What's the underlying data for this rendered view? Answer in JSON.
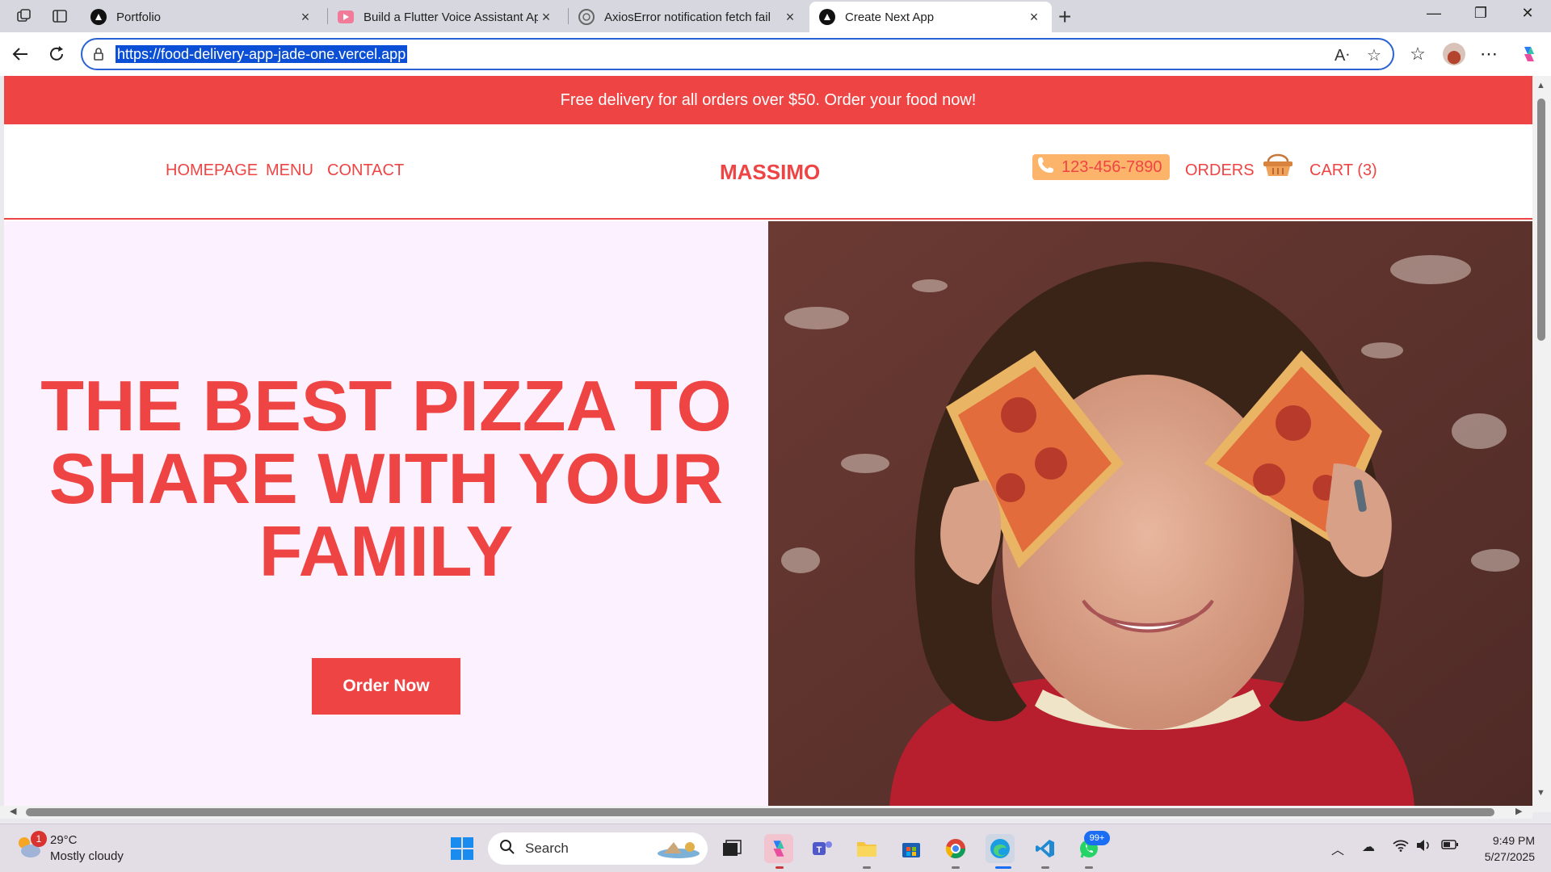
{
  "browser": {
    "tabs": [
      {
        "title": "Portfolio",
        "favicon": "vercel-triangle-icon"
      },
      {
        "title": "Build a Flutter Voice Assistant App",
        "favicon": "youtube-icon"
      },
      {
        "title": "AxiosError notification fetch fail",
        "favicon": "openai-icon"
      },
      {
        "title": "Create Next App",
        "favicon": "vercel-triangle-icon",
        "active": true
      }
    ],
    "new_tab_label": "+",
    "url": "https://food-delivery-app-jade-one.vercel.app"
  },
  "page": {
    "promo_text": "Free delivery for all orders over $50. Order your food now!",
    "nav_links": [
      "HOMEPAGE",
      "MENU",
      "CONTACT"
    ],
    "brand": "MASSIMO",
    "phone": "123-456-7890",
    "orders_label": "ORDERS",
    "cart_label": "CART (3)",
    "hero_title": "THE BEST PIZZA TO SHARE WITH YOUR FAMILY",
    "cta_label": "Order Now",
    "hero_image": "smiling person holding two pizza slices over eyes",
    "colors": {
      "accent": "#ef4444",
      "phone_bg": "#fcb36a",
      "hero_bg": "#fcf1fe"
    }
  },
  "taskbar": {
    "weather_temp": "29°C",
    "weather_desc": "Mostly cloudy",
    "weather_badge": "1",
    "search_placeholder": "Search",
    "notification_badge": "99+",
    "time": "9:49 PM",
    "date": "5/27/2025"
  }
}
